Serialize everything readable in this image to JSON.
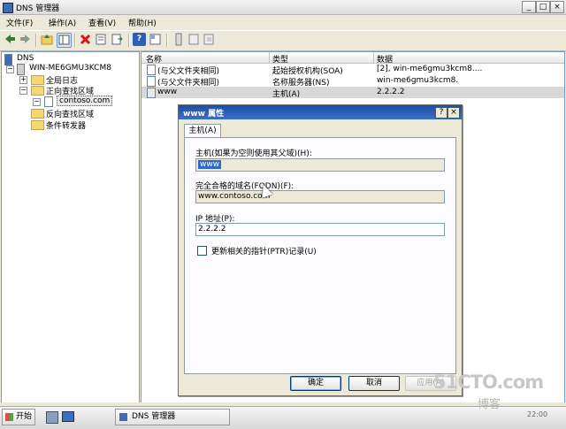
{
  "window": {
    "title": "DNS 管理器",
    "controls": {
      "minimize": "_",
      "maximize": "□",
      "close": "×"
    }
  },
  "menu": [
    {
      "label": "文件(F)"
    },
    {
      "label": "操作(A)"
    },
    {
      "label": "查看(V)"
    },
    {
      "label": "帮助(H)"
    }
  ],
  "toolbar": {
    "icons": [
      "back-icon",
      "forward-icon",
      "up-folder-icon",
      "show-tree-icon",
      "delete-icon",
      "properties-icon",
      "export-icon",
      "help-icon",
      "view-icon",
      "new-record-icon",
      "new-host-icon",
      "new-alias-icon"
    ]
  },
  "tree": {
    "root": "DNS",
    "server": "WIN-ME6GMU3KCM8",
    "items": [
      {
        "label": "全局日志"
      },
      {
        "label": "正向查找区域"
      },
      {
        "label": "contoso.com"
      },
      {
        "label": "反向查找区域"
      },
      {
        "label": "条件转发器"
      }
    ],
    "expand_collapsed": "+",
    "expand_open": "−"
  },
  "list": {
    "columns": [
      "名称",
      "类型",
      "数据"
    ],
    "rows": [
      {
        "name": "(与父文件夹相同)",
        "type": "起始授权机构(SOA)",
        "data": "[2], win-me6gmu3kcm8...."
      },
      {
        "name": "(与父文件夹相同)",
        "type": "名称服务器(NS)",
        "data": "win-me6gmu3kcm8."
      },
      {
        "name": "www",
        "type": "主机(A)",
        "data": "2.2.2.2"
      }
    ]
  },
  "dialog": {
    "title": "www 属性",
    "help_button": "?",
    "close_button": "×",
    "tab": "主机(A)",
    "host_label": "主机(如果为空则使用其父域)(H):",
    "host_value": "www",
    "fqdn_label": "完全合格的域名(FQDN)(F):",
    "fqdn_value": "www.contoso.com",
    "ip_label": "IP 地址(P):",
    "ip_value": "2.2.2.2",
    "ptr_label": "更新相关的指针(PTR)记录(U)",
    "ptr_checked": false,
    "ok": "确定",
    "cancel": "取消",
    "apply": "应用(A)"
  },
  "taskbar": {
    "start": "开始",
    "task": "DNS 管理器",
    "clock": "22:00"
  },
  "watermark": {
    "site": "51CTO.com",
    "blog": "博客"
  }
}
